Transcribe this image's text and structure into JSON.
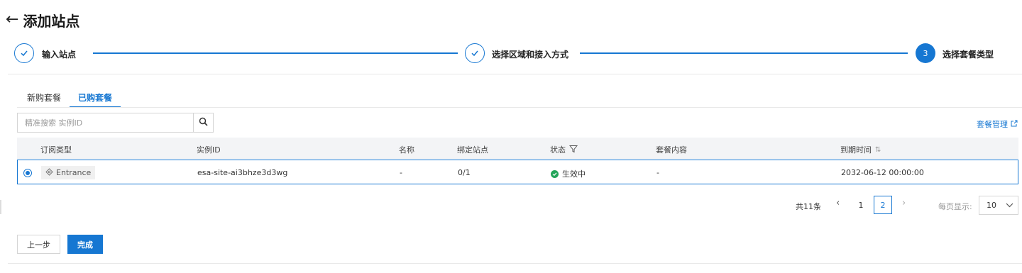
{
  "header": {
    "title": "添加站点"
  },
  "steps": [
    {
      "label": "输入站点",
      "state": "done"
    },
    {
      "label": "选择区域和接入方式",
      "state": "done"
    },
    {
      "label": "选择套餐类型",
      "number": "3",
      "state": "active"
    }
  ],
  "tabs": [
    {
      "label": "新购套餐",
      "active": false
    },
    {
      "label": "已购套餐",
      "active": true
    }
  ],
  "search": {
    "placeholder": "精准搜索 实例ID",
    "value": ""
  },
  "manage_link": "套餐管理",
  "table": {
    "columns": [
      "订阅类型",
      "实例ID",
      "名称",
      "绑定站点",
      "状态",
      "套餐内容",
      "到期时间"
    ],
    "rows": [
      {
        "selected": true,
        "type": "Entrance",
        "instance_id": "esa-site-ai3bhze3d3wg",
        "name": "-",
        "bound_sites": "0/1",
        "status": "生效中",
        "content": "-",
        "expire": "2032-06-12 00:00:00"
      }
    ]
  },
  "pagination": {
    "total": "共11条",
    "pages": [
      "1",
      "2"
    ],
    "current": "2",
    "page_size_label": "每页显示:",
    "page_size": "10"
  },
  "buttons": {
    "prev": "上一步",
    "finish": "完成"
  },
  "colors": {
    "accent": "#1677d2",
    "success": "#23a559"
  }
}
